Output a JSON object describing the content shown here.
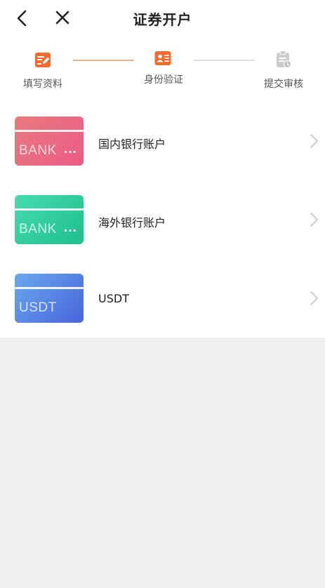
{
  "header": {
    "title": "证券开户"
  },
  "steps": [
    {
      "label": "填写资料",
      "state": "done"
    },
    {
      "label": "身份验证",
      "state": "active"
    },
    {
      "label": "提交审核",
      "state": "pending"
    }
  ],
  "options": [
    {
      "label": "国内银行账户",
      "card_text": "BANK",
      "card_dots": "...",
      "gradient": [
        "#e97a7e",
        "#ec5b86"
      ]
    },
    {
      "label": "海外银行账户",
      "card_text": "BANK",
      "card_dots": "...",
      "gradient": [
        "#45dcb0",
        "#1fbf8c"
      ]
    },
    {
      "label": "USDT",
      "card_text": "USDT",
      "card_dots": "",
      "gradient": [
        "#6aa8ee",
        "#4765dc"
      ]
    }
  ],
  "colors": {
    "accent": "#f26b2f",
    "muted_icon": "#cccccc",
    "line_active": "#e9b38a",
    "line_inactive": "#dddddd"
  }
}
